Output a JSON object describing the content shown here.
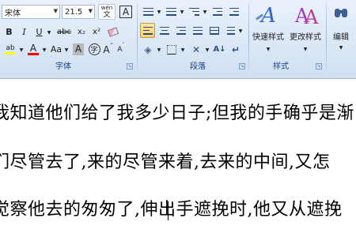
{
  "ribbon": {
    "font_group": {
      "label": "字体",
      "font_name": "宋体",
      "font_size": "21.5",
      "wen_button": "wén",
      "font_color_letter": "A",
      "bold": "B",
      "italic": "I",
      "underline": "U",
      "strikethrough": "abc",
      "subscript": "x₂",
      "superscript": "x²",
      "highlight_letter": "ab",
      "font_color_a": "A",
      "change_case": "Aa",
      "char_shading": "A",
      "enclose_char": "字",
      "grow_font": "A",
      "shrink_font": "A"
    },
    "paragraph_group": {
      "label": "段落"
    },
    "styles_group": {
      "label": "样式",
      "quick_styles": "快速样式",
      "change_styles": "更改样式"
    },
    "editing_group": {
      "label": "编辑"
    },
    "colors": {
      "highlight_yellow": "#ffff00",
      "font_red": "#ff0000",
      "label_blue": "#15428b"
    }
  },
  "document": {
    "lines": [
      "我知道他们给了我多少日子;但我的手确乎是渐",
      "们尽管去了,来的尽管来着,去来的中间,又怎",
      "觉察他去的匆匆了,伸出手遮挽时,他又从遮挽"
    ]
  }
}
